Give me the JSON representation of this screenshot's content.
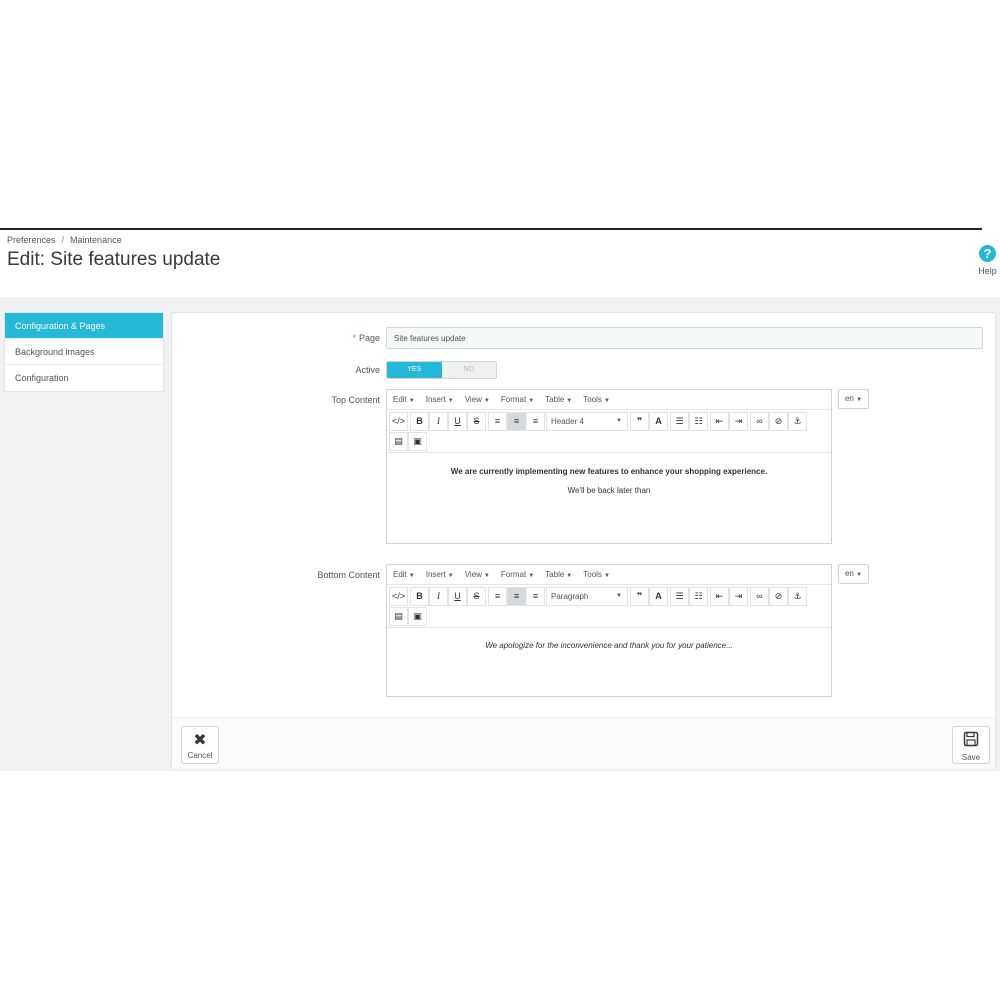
{
  "breadcrumb": [
    "Preferences",
    "Maintenance"
  ],
  "breadcrumb_separator": "/",
  "page_title": "Edit: Site features update",
  "help": {
    "icon": "?",
    "label": "Help"
  },
  "side_tabs": [
    {
      "label": "Configuration & Pages",
      "active": true
    },
    {
      "label": "Background images",
      "active": false
    },
    {
      "label": "Configuration",
      "active": false
    }
  ],
  "form": {
    "page_required": "*",
    "page_label": "Page",
    "page_value": "Site features update",
    "active_label": "Active",
    "active_yes": "YES",
    "active_no": "NO",
    "top_content_label": "Top Content",
    "bottom_content_label": "Bottom Content"
  },
  "editor_menus": [
    "Edit",
    "Insert",
    "View",
    "Format",
    "Table",
    "Tools"
  ],
  "top_editor": {
    "format": "Header 4",
    "line1": "We are currently implementing new features to enhance your shopping experience.",
    "line2": "We'll be back later than",
    "lang": "en"
  },
  "bottom_editor": {
    "format": "Paragraph",
    "line1": "We apologize for the inconvenience and thank you for your patience...",
    "lang": "en"
  },
  "footer": {
    "cancel": "Cancel",
    "save": "Save"
  },
  "colors": {
    "accent": "#25b9d7",
    "title": "#363a41",
    "background": "#eff1f2"
  }
}
